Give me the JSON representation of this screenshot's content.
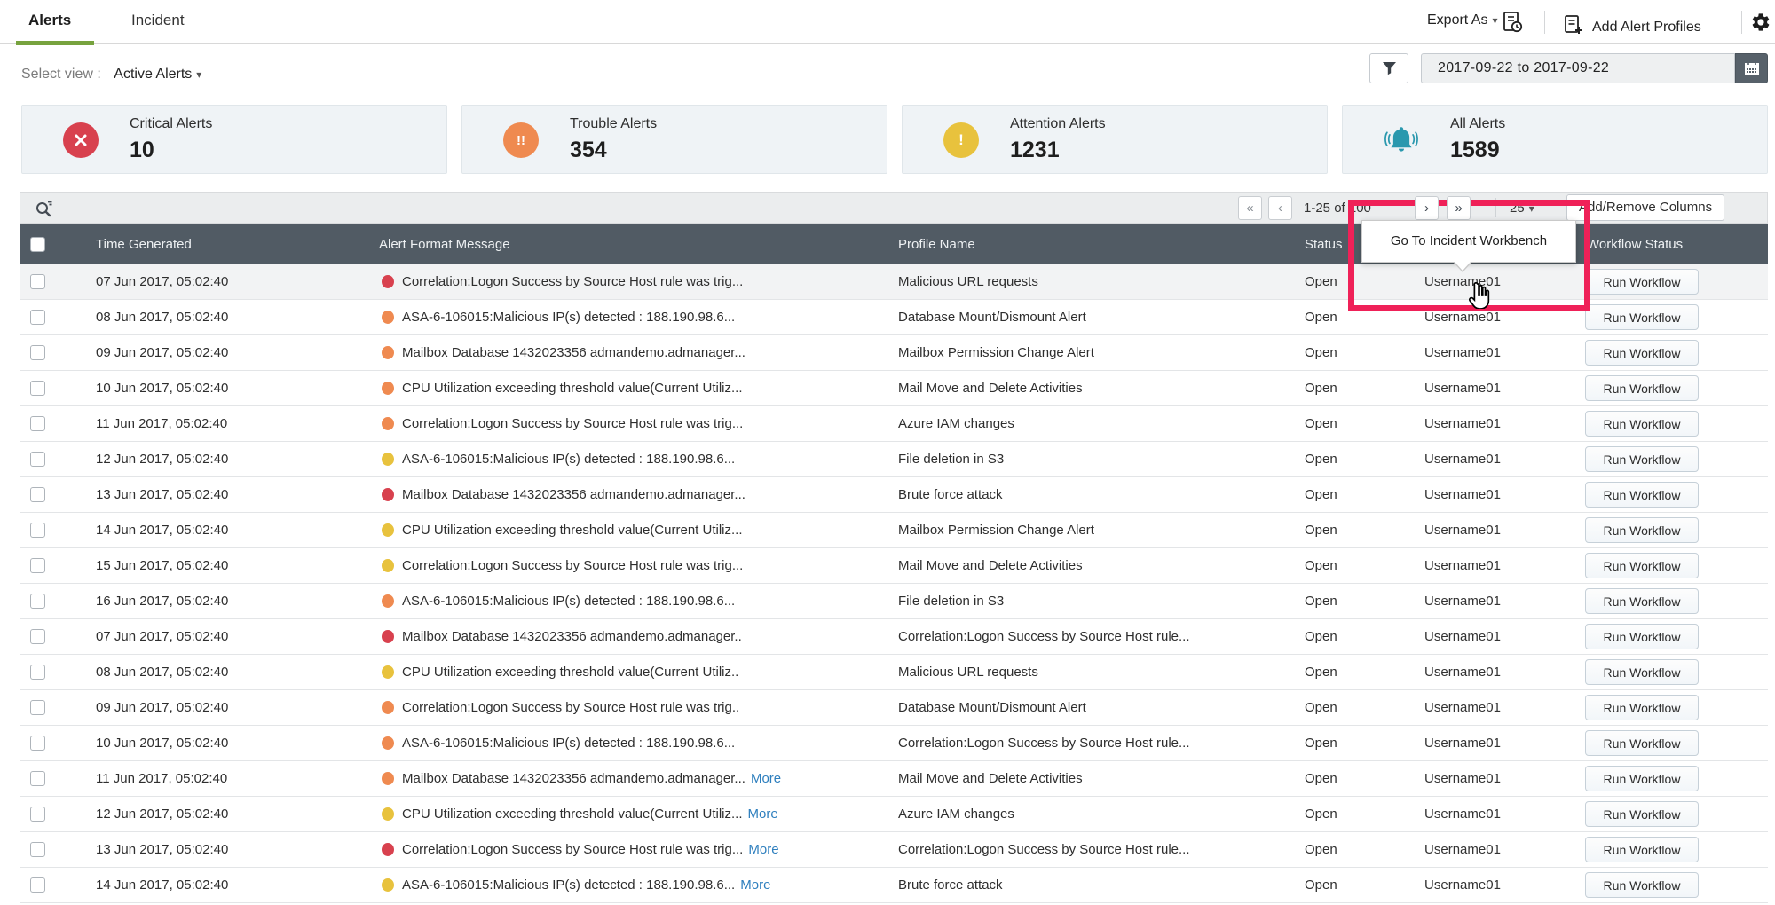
{
  "colors": {
    "tab_accent": "#77a33e",
    "highlight_pink": "#ef2158",
    "critical": "#d8414e",
    "trouble": "#ef8a50",
    "attention": "#e8c23d",
    "all_alerts": "#2a98ae",
    "link_blue": "#2e7fbe"
  },
  "tabs": [
    {
      "label": "Alerts",
      "active": true
    },
    {
      "label": "Incident",
      "active": false
    }
  ],
  "header_actions": {
    "export_label": "Export As",
    "add_profiles_label": "Add Alert Profiles"
  },
  "view_selector": {
    "label": "Select view :",
    "value": "Active Alerts"
  },
  "date_range": {
    "value": "2017-09-22  to  2017-09-22"
  },
  "summary_cards": [
    {
      "id": "critical",
      "label": "Critical Alerts",
      "value": "10"
    },
    {
      "id": "trouble",
      "label": "Trouble Alerts",
      "value": "354"
    },
    {
      "id": "attention",
      "label": "Attention Alerts",
      "value": "1231"
    },
    {
      "id": "all",
      "label": "All Alerts",
      "value": "1589"
    }
  ],
  "pagination": {
    "range_label": "1-25 of 100",
    "page_size": "25"
  },
  "add_remove_columns_label": "Add/Remove Columns",
  "tooltip_text": "Go To Incident Workbench",
  "table": {
    "columns": {
      "time": "Time Generated",
      "message": "Alert Format Message",
      "profile": "Profile Name",
      "status": "Status",
      "workflow": "Workflow Status"
    },
    "more_label": "More",
    "run_workflow_label": "Run Workflow",
    "rows": [
      {
        "time": "07 Jun 2017, 05:02:40",
        "severity": "critical",
        "message": "Correlation:Logon Success by Source Host rule was trig...",
        "more": false,
        "profile": "Malicious URL requests",
        "status": "Open",
        "technician": "Username01",
        "highlighted": true
      },
      {
        "time": "08 Jun 2017, 05:02:40",
        "severity": "trouble",
        "message": "ASA-6-106015:Malicious IP(s) detected : 188.190.98.6...",
        "more": false,
        "profile": "Database Mount/Dismount Alert",
        "status": "Open",
        "technician": "Username01",
        "highlighted": false
      },
      {
        "time": "09 Jun 2017, 05:02:40",
        "severity": "trouble",
        "message": "Mailbox Database 1432023356 admandemo.admanager...",
        "more": false,
        "profile": "Mailbox Permission Change Alert",
        "status": "Open",
        "technician": "Username01",
        "highlighted": false
      },
      {
        "time": "10 Jun 2017, 05:02:40",
        "severity": "trouble",
        "message": "CPU Utilization exceeding threshold value(Current Utiliz...",
        "more": false,
        "profile": "Mail Move and Delete Activities",
        "status": "Open",
        "technician": "Username01",
        "highlighted": false
      },
      {
        "time": "11 Jun 2017, 05:02:40",
        "severity": "trouble",
        "message": "Correlation:Logon Success by Source Host rule was trig...",
        "more": false,
        "profile": "Azure IAM changes",
        "status": "Open",
        "technician": "Username01",
        "highlighted": false
      },
      {
        "time": "12 Jun 2017, 05:02:40",
        "severity": "attention",
        "message": "ASA-6-106015:Malicious IP(s) detected : 188.190.98.6...",
        "more": false,
        "profile": "File deletion in S3",
        "status": "Open",
        "technician": "Username01",
        "highlighted": false
      },
      {
        "time": "13 Jun 2017, 05:02:40",
        "severity": "critical",
        "message": "Mailbox Database 1432023356 admandemo.admanager...",
        "more": false,
        "profile": "Brute force attack",
        "status": "Open",
        "technician": "Username01",
        "highlighted": false
      },
      {
        "time": "14 Jun 2017, 05:02:40",
        "severity": "attention",
        "message": "CPU Utilization exceeding threshold value(Current Utiliz...",
        "more": false,
        "profile": "Mailbox Permission Change Alert",
        "status": "Open",
        "technician": "Username01",
        "highlighted": false
      },
      {
        "time": "15 Jun 2017, 05:02:40",
        "severity": "attention",
        "message": "Correlation:Logon Success by Source Host rule was trig...",
        "more": false,
        "profile": "Mail Move and Delete Activities",
        "status": "Open",
        "technician": "Username01",
        "highlighted": false
      },
      {
        "time": "16 Jun 2017, 05:02:40",
        "severity": "trouble",
        "message": "ASA-6-106015:Malicious IP(s) detected : 188.190.98.6...",
        "more": false,
        "profile": "File deletion in S3",
        "status": "Open",
        "technician": "Username01",
        "highlighted": false
      },
      {
        "time": "07 Jun 2017, 05:02:40",
        "severity": "critical",
        "message": "Mailbox Database 1432023356 admandemo.admanager..",
        "more": false,
        "profile": "Correlation:Logon Success by Source Host rule...",
        "status": "Open",
        "technician": "Username01",
        "highlighted": false
      },
      {
        "time": "08 Jun 2017, 05:02:40",
        "severity": "attention",
        "message": "CPU Utilization exceeding threshold value(Current Utiliz..",
        "more": false,
        "profile": "Malicious URL requests",
        "status": "Open",
        "technician": "Username01",
        "highlighted": false
      },
      {
        "time": "09 Jun 2017, 05:02:40",
        "severity": "trouble",
        "message": "Correlation:Logon Success by Source Host rule was trig..",
        "more": false,
        "profile": "Database Mount/Dismount Alert",
        "status": "Open",
        "technician": "Username01",
        "highlighted": false
      },
      {
        "time": "10 Jun 2017, 05:02:40",
        "severity": "trouble",
        "message": "ASA-6-106015:Malicious IP(s) detected : 188.190.98.6...",
        "more": false,
        "profile": "Correlation:Logon Success by Source Host rule...",
        "status": "Open",
        "technician": "Username01",
        "highlighted": false
      },
      {
        "time": "11 Jun 2017, 05:02:40",
        "severity": "trouble",
        "message": "Mailbox Database 1432023356 admandemo.admanager...",
        "more": true,
        "profile": "Mail Move and Delete Activities",
        "status": "Open",
        "technician": "Username01",
        "highlighted": false
      },
      {
        "time": "12 Jun 2017, 05:02:40",
        "severity": "attention",
        "message": "CPU Utilization exceeding threshold value(Current Utiliz...",
        "more": true,
        "profile": "Azure IAM changes",
        "status": "Open",
        "technician": "Username01",
        "highlighted": false
      },
      {
        "time": "13 Jun 2017, 05:02:40",
        "severity": "critical",
        "message": "Correlation:Logon Success by Source Host rule was trig...",
        "more": true,
        "profile": "Correlation:Logon Success by Source Host rule...",
        "status": "Open",
        "technician": "Username01",
        "highlighted": false
      },
      {
        "time": "14 Jun 2017, 05:02:40",
        "severity": "attention",
        "message": "ASA-6-106015:Malicious IP(s) detected : 188.190.98.6...",
        "more": true,
        "profile": "Brute force attack",
        "status": "Open",
        "technician": "Username01",
        "highlighted": false
      }
    ]
  }
}
